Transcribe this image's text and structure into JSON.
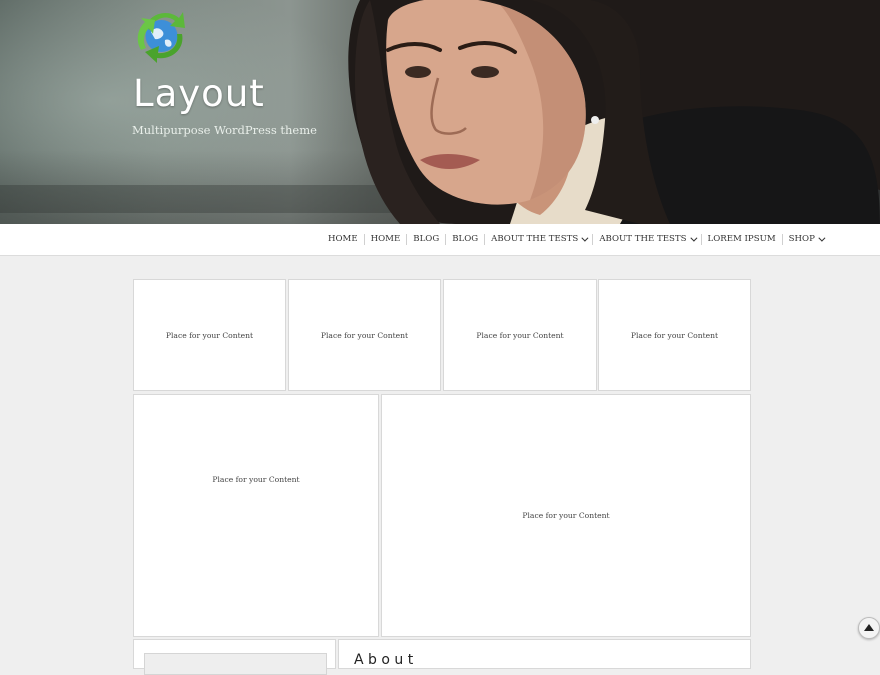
{
  "header": {
    "site_title": "Layout",
    "tagline": "Multipurpose WordPress theme",
    "logo_icon": "recycle-globe-icon"
  },
  "nav": {
    "items": [
      {
        "label": "HOME",
        "has_dropdown": false
      },
      {
        "label": "HOME",
        "has_dropdown": false
      },
      {
        "label": "BLOG",
        "has_dropdown": false
      },
      {
        "label": "BLOG",
        "has_dropdown": false
      },
      {
        "label": "ABOUT THE TESTS",
        "has_dropdown": true
      },
      {
        "label": "ABOUT THE TESTS",
        "has_dropdown": true
      },
      {
        "label": "LOREM IPSUM",
        "has_dropdown": false
      },
      {
        "label": "SHOP",
        "has_dropdown": true
      }
    ]
  },
  "content": {
    "boxes": [
      {
        "text": "Place for your Content"
      },
      {
        "text": "Place for your Content"
      },
      {
        "text": "Place for your Content"
      },
      {
        "text": "Place for your Content"
      },
      {
        "text": "Place for your Content"
      },
      {
        "text": "Place for your Content"
      }
    ]
  },
  "widgets": {
    "second_title": "A b o u t"
  },
  "scroll_top": {
    "icon": "arrow-up-icon"
  },
  "colors": {
    "page_bg": "#efefef",
    "box_bg": "#ffffff",
    "nav_text": "#333333",
    "logo_green": "#4caf2f",
    "logo_blue": "#2f7fd1"
  }
}
